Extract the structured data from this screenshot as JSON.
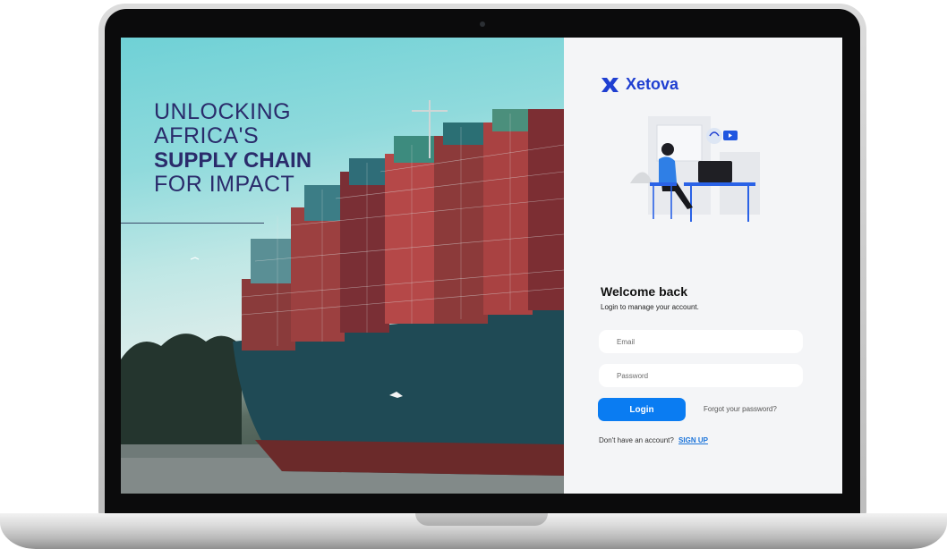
{
  "hero": {
    "line1": "UNLOCKING",
    "line2": "AFRICA'S",
    "line3": "SUPPLY CHAIN",
    "line4": "FOR IMPACT"
  },
  "brand": {
    "name": "Xetova",
    "icon": "xetova-logo-icon",
    "color": "#1f3fd1"
  },
  "login": {
    "title": "Welcome back",
    "subtitle": "Login to manage your account.",
    "email_placeholder": "Email",
    "password_placeholder": "Password",
    "login_label": "Login",
    "forgot_label": "Forgot your password?",
    "signup_prompt": "Don't have an account?",
    "signup_label": "SIGN UP"
  },
  "colors": {
    "accent": "#0a7cf2",
    "panel_bg": "#f4f5f7",
    "hero_text": "#2a2b6b"
  }
}
